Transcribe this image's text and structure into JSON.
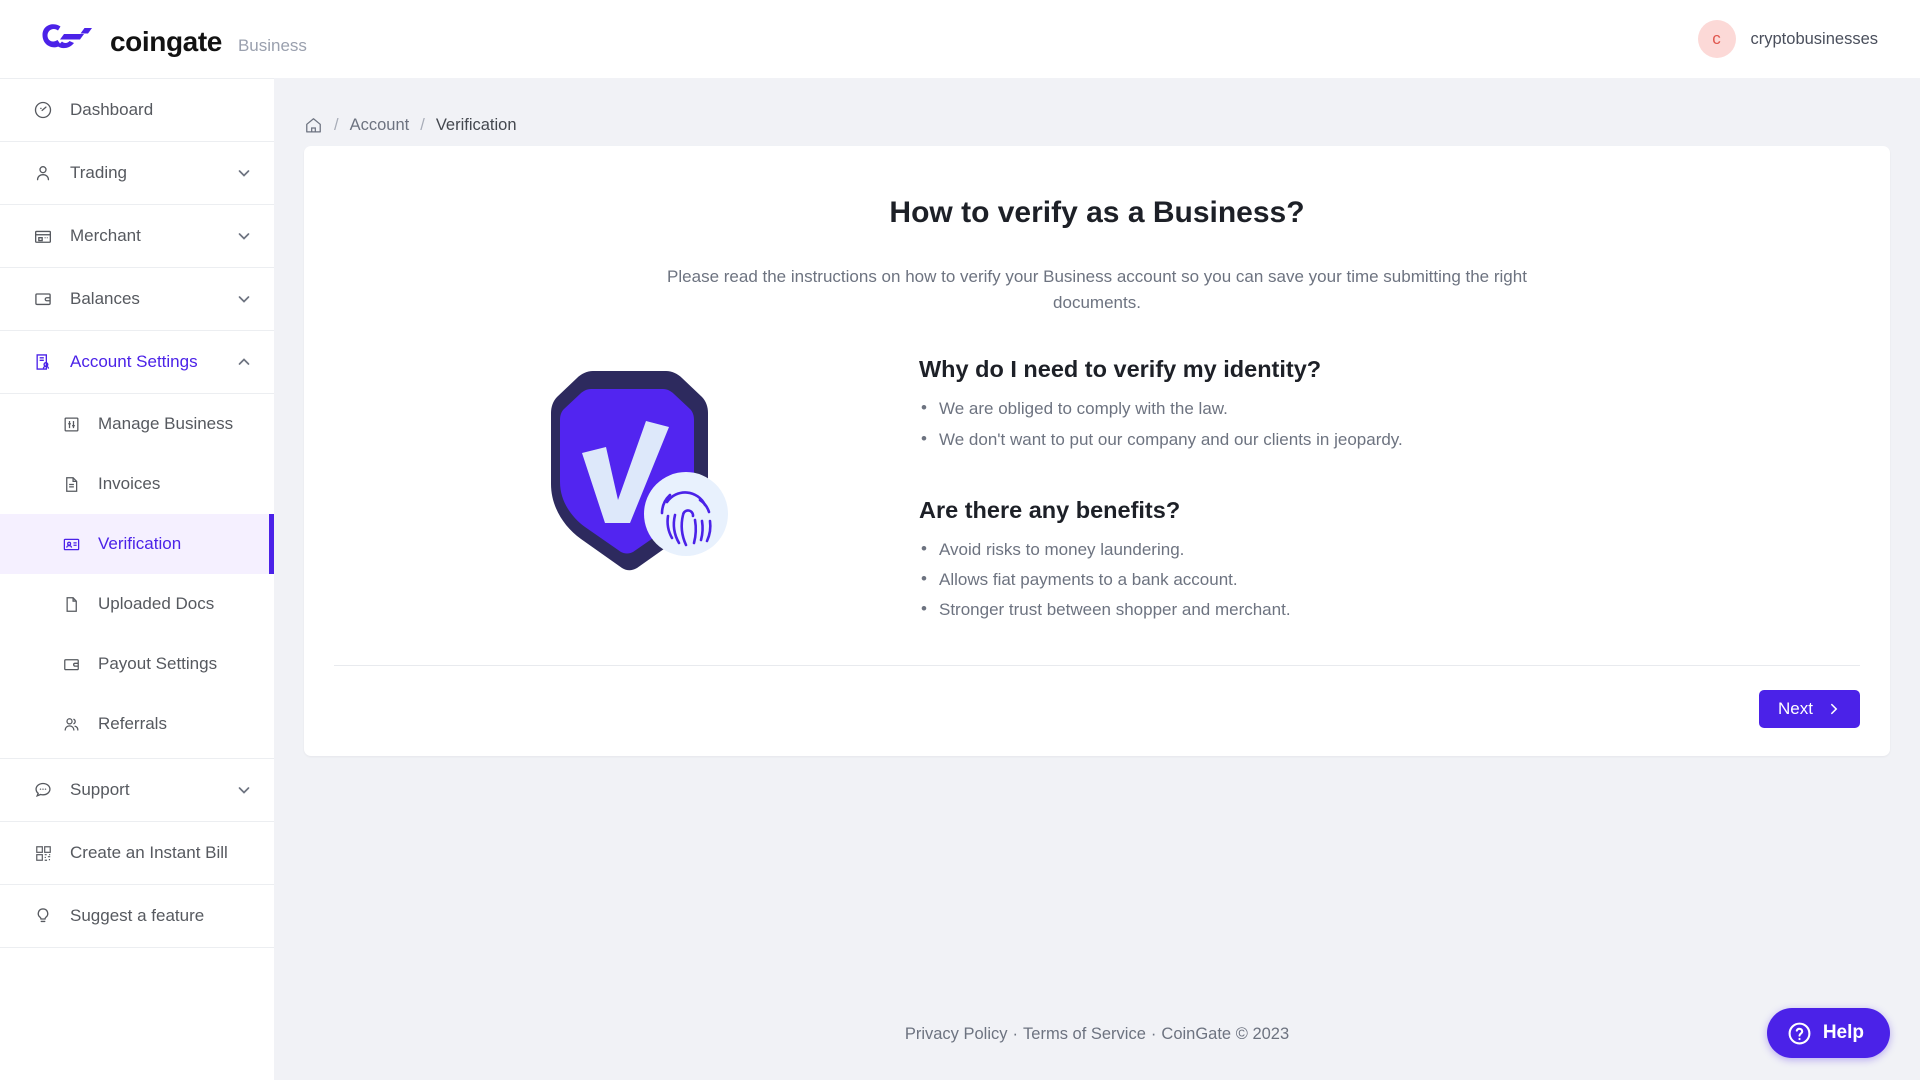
{
  "brand": {
    "logo_icon": "coingate-logo-icon",
    "name": "coingate",
    "suffix": "Business"
  },
  "user": {
    "avatar_initial": "c",
    "name": "cryptobusinesses",
    "avatar_bg": "#fcd9d7",
    "avatar_fg": "#e0564d"
  },
  "sidebar": {
    "items": [
      {
        "label": "Dashboard",
        "icon": "speedometer-icon",
        "expandable": false,
        "active": false
      },
      {
        "label": "Trading",
        "icon": "person-icon",
        "expandable": true,
        "expanded": false,
        "active": false
      },
      {
        "label": "Merchant",
        "icon": "storefront-icon",
        "expandable": true,
        "expanded": false,
        "active": false
      },
      {
        "label": "Balances",
        "icon": "wallet-icon",
        "expandable": true,
        "expanded": false,
        "active": false
      },
      {
        "label": "Account Settings",
        "icon": "account-settings-icon",
        "expandable": true,
        "expanded": true,
        "active": true
      }
    ],
    "sub_items": [
      {
        "label": "Manage Business",
        "icon": "sliders-icon",
        "active": false
      },
      {
        "label": "Invoices",
        "icon": "document-lines-icon",
        "active": false
      },
      {
        "label": "Verification",
        "icon": "id-card-icon",
        "active": true
      },
      {
        "label": "Uploaded Docs",
        "icon": "document-blank-icon",
        "active": false
      },
      {
        "label": "Payout Settings",
        "icon": "wallet-icon",
        "active": false
      },
      {
        "label": "Referrals",
        "icon": "people-icon",
        "active": false
      }
    ],
    "bottom_items": [
      {
        "label": "Support",
        "icon": "chat-bubble-icon",
        "expandable": true,
        "expanded": false
      },
      {
        "label": "Create an Instant Bill",
        "icon": "qr-code-icon",
        "expandable": false
      },
      {
        "label": "Suggest a feature",
        "icon": "lightbulb-icon",
        "expandable": false
      }
    ],
    "active_accent": "#4b22e8",
    "active_bg": "#f5f0ff"
  },
  "breadcrumb": {
    "home_icon": "home-icon",
    "separator": "/",
    "items": [
      {
        "label": "Account",
        "current": false
      },
      {
        "label": "Verification",
        "current": true
      }
    ]
  },
  "main": {
    "title": "How to verify as a Business?",
    "intro": "Please read the instructions on how to verify your Business account so you can save your time submitting the right documents.",
    "illustration_icon": "shield-check-fingerprint-illustration",
    "sections": [
      {
        "heading": "Why do I need to verify my identity?",
        "bullets": [
          "We are obliged to comply with the law.",
          "We don't want to put our company and our clients in jeopardy."
        ]
      },
      {
        "heading": "Are there any benefits?",
        "bullets": [
          "Avoid risks to money laundering.",
          "Allows fiat payments to a bank account.",
          "Stronger trust between shopper and merchant."
        ]
      }
    ],
    "next_button": {
      "label": "Next",
      "icon": "chevron-right-icon",
      "color": "#4b22e8"
    }
  },
  "footer": {
    "privacy": "Privacy Policy",
    "terms": "Terms of Service",
    "copyright": "CoinGate © 2023",
    "separator": "·"
  },
  "help": {
    "label": "Help",
    "icon": "question-circle-icon",
    "color": "#4b22e8"
  }
}
